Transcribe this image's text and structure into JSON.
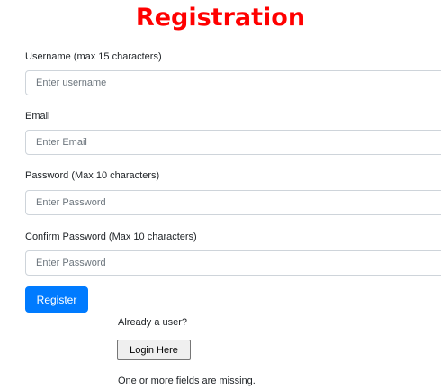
{
  "header": {
    "title": "Registration"
  },
  "form": {
    "username": {
      "label": "Username (max 15 characters)",
      "placeholder": "Enter username",
      "value": ""
    },
    "email": {
      "label": "Email",
      "placeholder": "Enter Email",
      "value": ""
    },
    "password": {
      "label": "Password (Max 10 characters)",
      "placeholder": "Enter Password",
      "value": ""
    },
    "confirm_password": {
      "label": "Confirm Password (Max 10 characters)",
      "placeholder": "Enter Password",
      "value": ""
    },
    "register_label": "Register"
  },
  "login": {
    "prompt": "Already a user?",
    "button_label": "Login Here"
  },
  "status": {
    "error_message": "One or more fields are missing."
  },
  "colors": {
    "title": "#ff0000",
    "primary_button": "#007bff",
    "input_border": "#ced4da"
  }
}
